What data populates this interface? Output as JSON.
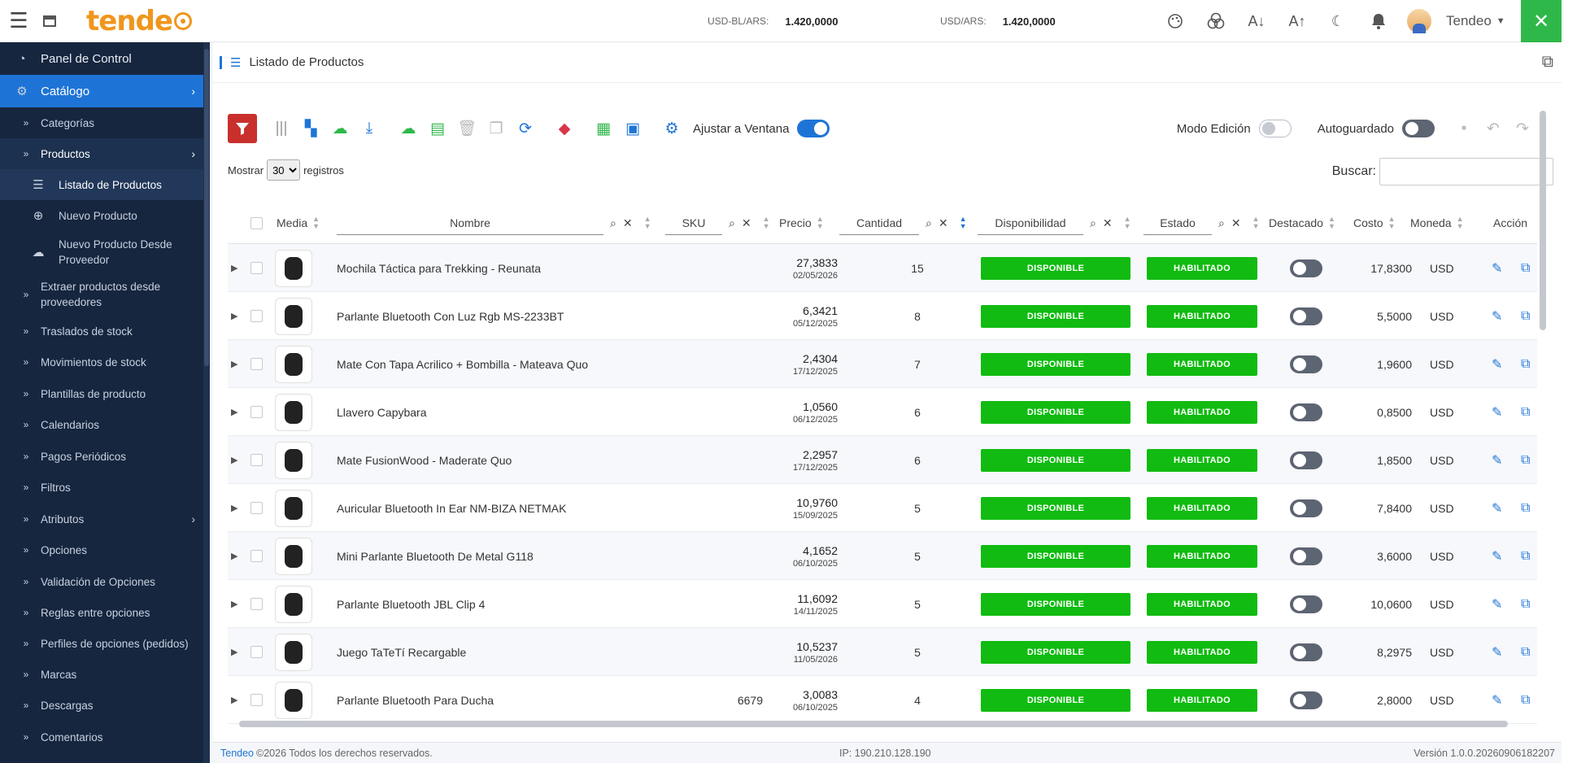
{
  "topbar": {
    "rate1_label": "USD-BL/ARS:",
    "rate1_value": "1.420,0000",
    "rate2_label": "USD/ARS:",
    "rate2_value": "1.420,0000",
    "user": "Tendeo"
  },
  "logo_text": "tende",
  "sidebar": {
    "items": [
      {
        "label": "Panel de Control",
        "icon": "dashboard-icon"
      },
      {
        "label": "Catálogo",
        "icon": "tags-icon"
      },
      {
        "label": "Categorías"
      },
      {
        "label": "Productos"
      },
      {
        "label": "Listado de Productos",
        "icon": "list-icon"
      },
      {
        "label": "Nuevo Producto",
        "icon": "plus-circle-icon"
      },
      {
        "label": "Nuevo Producto Desde Proveedor",
        "icon": "cloud-icon"
      },
      {
        "label": "Extraer productos desde proveedores"
      },
      {
        "label": "Traslados de stock"
      },
      {
        "label": "Movimientos de stock"
      },
      {
        "label": "Plantillas de producto"
      },
      {
        "label": "Calendarios"
      },
      {
        "label": "Pagos Periódicos"
      },
      {
        "label": "Filtros"
      },
      {
        "label": "Atributos"
      },
      {
        "label": "Opciones"
      },
      {
        "label": "Validación de Opciones"
      },
      {
        "label": "Reglas entre opciones"
      },
      {
        "label": "Perfiles de opciones (pedidos)"
      },
      {
        "label": "Marcas"
      },
      {
        "label": "Descargas"
      },
      {
        "label": "Comentarios"
      }
    ]
  },
  "page": {
    "title": "Listado de Productos"
  },
  "toolbar": {
    "fit_label": "Ajustar a Ventana",
    "edit_mode_label": "Modo Edición",
    "autosave_label": "Autoguardado"
  },
  "list": {
    "show_label": "Mostrar",
    "page_size": "30",
    "records_label": "registros",
    "search_label": "Buscar:"
  },
  "columns": {
    "media": "Media",
    "name": "Nombre",
    "sku": "SKU",
    "price": "Precio",
    "qty": "Cantidad",
    "availability": "Disponibilidad",
    "status": "Estado",
    "featured": "Destacado",
    "cost": "Costo",
    "currency": "Moneda",
    "action": "Acción"
  },
  "rows": [
    {
      "name": "Mochila Táctica para Trekking - Reunata",
      "sku": "",
      "price": "27,3833",
      "date": "02/05/2026",
      "qty": "15",
      "availability": "DISPONIBLE",
      "status": "HABILITADO",
      "cost": "17,8300",
      "currency": "USD"
    },
    {
      "name": "Parlante Bluetooth Con Luz Rgb MS-2233BT",
      "sku": "",
      "price": "6,3421",
      "date": "05/12/2025",
      "qty": "8",
      "availability": "DISPONIBLE",
      "status": "HABILITADO",
      "cost": "5,5000",
      "currency": "USD"
    },
    {
      "name": "Mate Con Tapa Acrilico + Bombilla - Mateava Quo",
      "sku": "",
      "price": "2,4304",
      "date": "17/12/2025",
      "qty": "7",
      "availability": "DISPONIBLE",
      "status": "HABILITADO",
      "cost": "1,9600",
      "currency": "USD"
    },
    {
      "name": "Llavero Capybara",
      "sku": "",
      "price": "1,0560",
      "date": "06/12/2025",
      "qty": "6",
      "availability": "DISPONIBLE",
      "status": "HABILITADO",
      "cost": "0,8500",
      "currency": "USD"
    },
    {
      "name": "Mate FusionWood - Maderate Quo",
      "sku": "",
      "price": "2,2957",
      "date": "17/12/2025",
      "qty": "6",
      "availability": "DISPONIBLE",
      "status": "HABILITADO",
      "cost": "1,8500",
      "currency": "USD"
    },
    {
      "name": "Auricular Bluetooth In Ear NM-BIZA NETMAK",
      "sku": "",
      "price": "10,9760",
      "date": "15/09/2025",
      "qty": "5",
      "availability": "DISPONIBLE",
      "status": "HABILITADO",
      "cost": "7,8400",
      "currency": "USD"
    },
    {
      "name": "Mini Parlante Bluetooth De Metal G118",
      "sku": "",
      "price": "4,1652",
      "date": "06/10/2025",
      "qty": "5",
      "availability": "DISPONIBLE",
      "status": "HABILITADO",
      "cost": "3,6000",
      "currency": "USD"
    },
    {
      "name": "Parlante Bluetooth JBL Clip 4",
      "sku": "",
      "price": "11,6092",
      "date": "14/11/2025",
      "qty": "5",
      "availability": "DISPONIBLE",
      "status": "HABILITADO",
      "cost": "10,0600",
      "currency": "USD"
    },
    {
      "name": "Juego TaTeTí Recargable",
      "sku": "",
      "price": "10,5237",
      "date": "11/05/2026",
      "qty": "5",
      "availability": "DISPONIBLE",
      "status": "HABILITADO",
      "cost": "8,2975",
      "currency": "USD"
    },
    {
      "name": "Parlante Bluetooth Para Ducha",
      "sku": "6679",
      "price": "3,0083",
      "date": "06/10/2025",
      "qty": "4",
      "availability": "DISPONIBLE",
      "status": "HABILITADO",
      "cost": "2,8000",
      "currency": "USD"
    }
  ],
  "footer": {
    "brand": "Tendeo",
    "copyright": "©2026 Todos los derechos reservados.",
    "ip": "IP: 190.210.128.190",
    "version": "Versión 1.0.0.20260906182207"
  },
  "colors": {
    "accent": "#1e74d6",
    "sidebar_bg": "#16263f",
    "badge_green": "#11bb11",
    "filter_red": "#c9302c",
    "tools_green": "#2fb84a",
    "logo_orange": "#f0961c"
  }
}
